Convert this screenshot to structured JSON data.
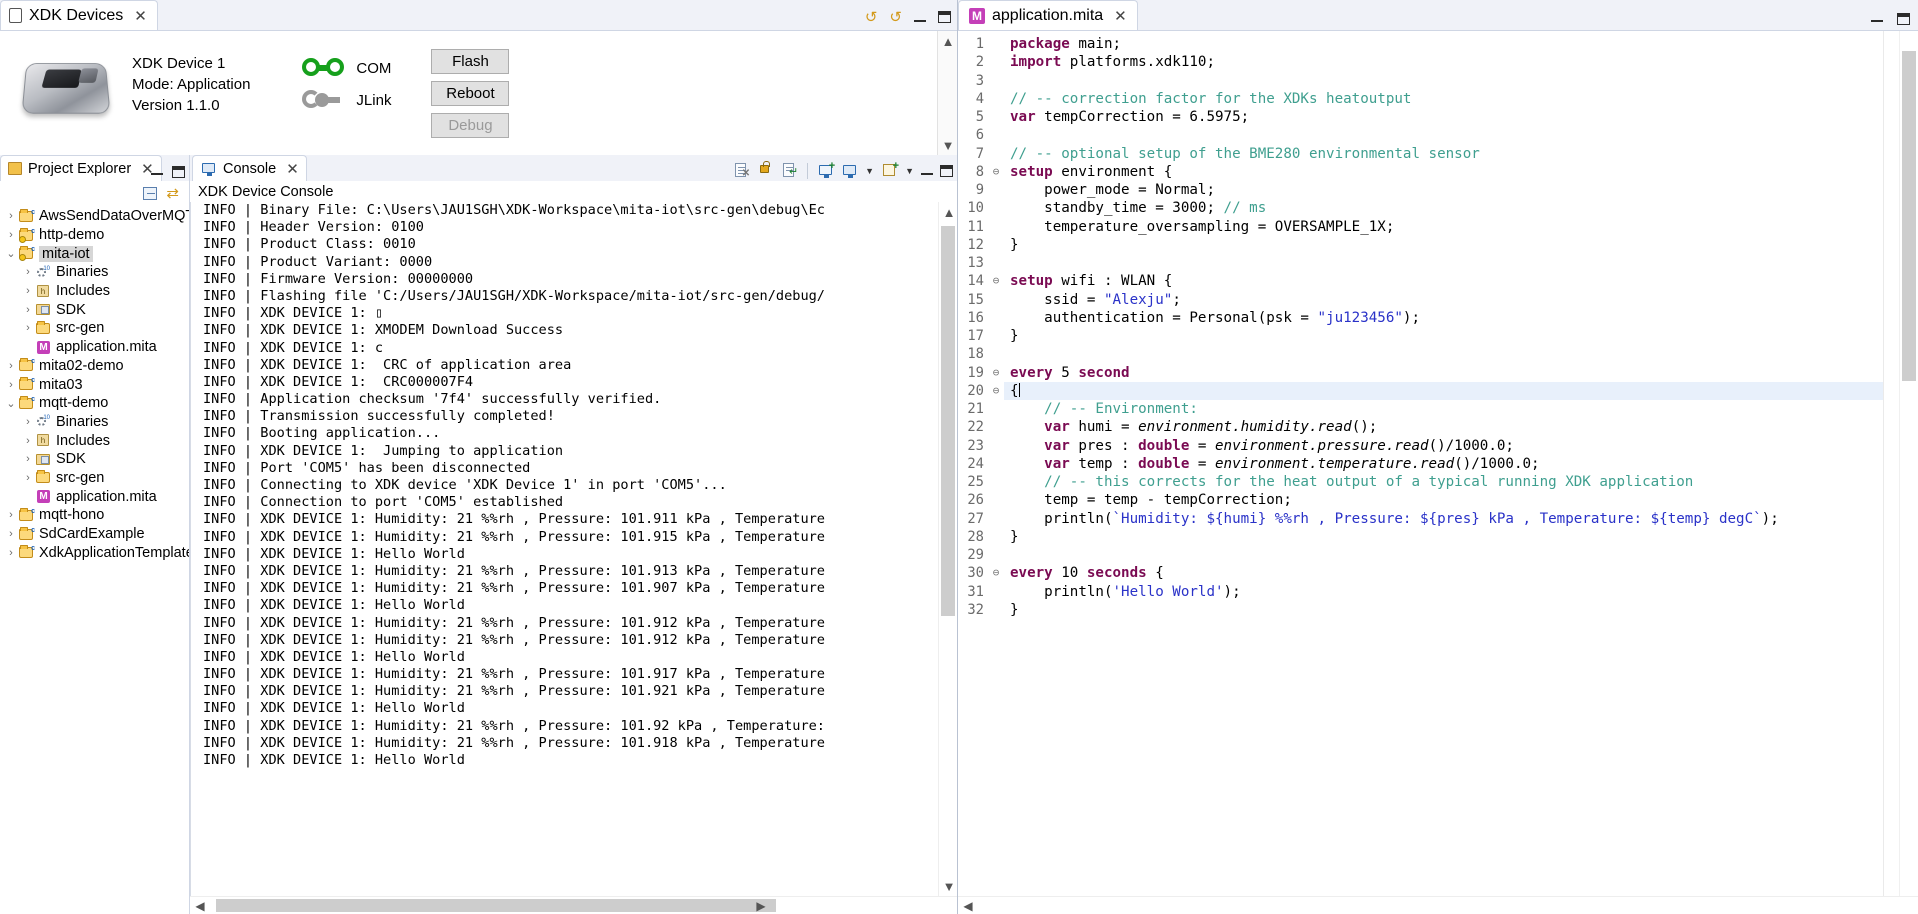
{
  "xdk_view": {
    "tab_label": "XDK Devices",
    "tab_close": "✕",
    "device_name": "XDK Device 1",
    "device_mode": "Mode: Application",
    "device_version": "Version 1.1.0",
    "connections": [
      {
        "label": "COM",
        "state": "on"
      },
      {
        "label": "JLink",
        "state": "off"
      }
    ],
    "buttons": [
      {
        "label": "Flash",
        "enabled": true
      },
      {
        "label": "Reboot",
        "enabled": true
      },
      {
        "label": "Debug",
        "enabled": false
      }
    ],
    "toolbar_icons": [
      "refresh-devices-icon",
      "refresh-device-console-icon",
      "minimize-icon",
      "maximize-icon"
    ]
  },
  "project_explorer": {
    "tab_label": "Project Explorer",
    "tab_close": "✕",
    "toolbar_icons": [
      "collapse-all-icon",
      "link-with-editor-icon"
    ],
    "tree": [
      {
        "label": "AwsSendDataOverMQTT",
        "indent": 0,
        "state": "collapsed",
        "icon": "c-project-folder",
        "selected": false
      },
      {
        "label": "http-demo",
        "indent": 0,
        "state": "collapsed",
        "icon": "c-project-folder-warn",
        "selected": false
      },
      {
        "label": "mita-iot",
        "indent": 0,
        "state": "expanded",
        "icon": "c-project-folder-warn",
        "selected": true
      },
      {
        "label": "Binaries",
        "indent": 1,
        "state": "collapsed",
        "icon": "binaries",
        "selected": false
      },
      {
        "label": "Includes",
        "indent": 1,
        "state": "collapsed",
        "icon": "includes",
        "selected": false
      },
      {
        "label": "SDK",
        "indent": 1,
        "state": "collapsed",
        "icon": "sdk-folder",
        "selected": false
      },
      {
        "label": "src-gen",
        "indent": 1,
        "state": "collapsed",
        "icon": "src-folder",
        "selected": false
      },
      {
        "label": "application.mita",
        "indent": 1,
        "state": "leaf",
        "icon": "mita-file",
        "selected": false
      },
      {
        "label": "mita02-demo",
        "indent": 0,
        "state": "collapsed",
        "icon": "c-project-folder",
        "selected": false
      },
      {
        "label": "mita03",
        "indent": 0,
        "state": "collapsed",
        "icon": "c-project-folder",
        "selected": false
      },
      {
        "label": "mqtt-demo",
        "indent": 0,
        "state": "expanded",
        "icon": "c-project-folder",
        "selected": false
      },
      {
        "label": "Binaries",
        "indent": 1,
        "state": "collapsed",
        "icon": "binaries",
        "selected": false
      },
      {
        "label": "Includes",
        "indent": 1,
        "state": "collapsed",
        "icon": "includes",
        "selected": false
      },
      {
        "label": "SDK",
        "indent": 1,
        "state": "collapsed",
        "icon": "sdk-folder",
        "selected": false
      },
      {
        "label": "src-gen",
        "indent": 1,
        "state": "collapsed",
        "icon": "src-folder",
        "selected": false
      },
      {
        "label": "application.mita",
        "indent": 1,
        "state": "leaf",
        "icon": "mita-file",
        "selected": false
      },
      {
        "label": "mqtt-hono",
        "indent": 0,
        "state": "collapsed",
        "icon": "c-project-folder",
        "selected": false
      },
      {
        "label": "SdCardExample",
        "indent": 0,
        "state": "collapsed",
        "icon": "c-project-folder",
        "selected": false
      },
      {
        "label": "XdkApplicationTemplate",
        "indent": 0,
        "state": "collapsed",
        "icon": "c-project-folder",
        "selected": false
      }
    ]
  },
  "console": {
    "tab_label": "Console",
    "tab_close": "✕",
    "title": "XDK Device Console",
    "toolbar_icons": [
      "clear-console-icon",
      "scroll-lock-icon",
      "pin-console-icon",
      "display-selected-console-icon",
      "open-console-icon",
      "minimize-icon",
      "maximize-icon"
    ],
    "lines": [
      "INFO | Binary File: C:\\Users\\JAU1SGH\\XDK-Workspace\\mita-iot\\src-gen\\debug\\Ec",
      "INFO | Header Version: 0100",
      "INFO | Product Class: 0010",
      "INFO | Product Variant: 0000",
      "INFO | Firmware Version: 00000000",
      "INFO | Flashing file 'C:/Users/JAU1SGH/XDK-Workspace/mita-iot/src-gen/debug/",
      "INFO | XDK DEVICE 1: ▯",
      "INFO | XDK DEVICE 1: XMODEM Download Success",
      "INFO | XDK DEVICE 1: c",
      "INFO | XDK DEVICE 1:  CRC of application area",
      "INFO | XDK DEVICE 1:  CRC000007F4",
      "INFO | Application checksum '7f4' successfully verified.",
      "INFO | Transmission successfully completed!",
      "INFO | Booting application...",
      "INFO | XDK DEVICE 1:  Jumping to application",
      "INFO | Port 'COM5' has been disconnected",
      "INFO | Connecting to XDK device 'XDK Device 1' in port 'COM5'...",
      "INFO | Connection to port 'COM5' established",
      "INFO | XDK DEVICE 1: Humidity: 21 %%rh , Pressure: 101.911 kPa , Temperature",
      "INFO | XDK DEVICE 1: Humidity: 21 %%rh , Pressure: 101.915 kPa , Temperature",
      "INFO | XDK DEVICE 1: Hello World",
      "INFO | XDK DEVICE 1: Humidity: 21 %%rh , Pressure: 101.913 kPa , Temperature",
      "INFO | XDK DEVICE 1: Humidity: 21 %%rh , Pressure: 101.907 kPa , Temperature",
      "INFO | XDK DEVICE 1: Hello World",
      "INFO | XDK DEVICE 1: Humidity: 21 %%rh , Pressure: 101.912 kPa , Temperature",
      "INFO | XDK DEVICE 1: Humidity: 21 %%rh , Pressure: 101.912 kPa , Temperature",
      "INFO | XDK DEVICE 1: Hello World",
      "INFO | XDK DEVICE 1: Humidity: 21 %%rh , Pressure: 101.917 kPa , Temperature",
      "INFO | XDK DEVICE 1: Humidity: 21 %%rh , Pressure: 101.921 kPa , Temperature",
      "INFO | XDK DEVICE 1: Hello World",
      "INFO | XDK DEVICE 1: Humidity: 21 %%rh , Pressure: 101.92 kPa , Temperature:",
      "INFO | XDK DEVICE 1: Humidity: 21 %%rh , Pressure: 101.918 kPa , Temperature",
      "INFO | XDK DEVICE 1: Hello World"
    ]
  },
  "editor": {
    "tab_label": "application.mita",
    "tab_close": "✕",
    "tab_icon_letter": "M",
    "current_line": 20,
    "window_controls": [
      "minimize-icon",
      "maximize-icon"
    ],
    "lines": [
      {
        "n": 1,
        "fold": "",
        "html": "<span class=\"kw\">package</span> main;"
      },
      {
        "n": 2,
        "fold": "",
        "html": "<span class=\"kw\">import</span> platforms.xdk110;"
      },
      {
        "n": 3,
        "fold": "",
        "html": ""
      },
      {
        "n": 4,
        "fold": "",
        "html": "<span class=\"cm\">// -- correction factor for the XDKs heatoutput</span>"
      },
      {
        "n": 5,
        "fold": "",
        "html": "<span class=\"kw\">var</span> tempCorrection = 6.5975;"
      },
      {
        "n": 6,
        "fold": "",
        "html": ""
      },
      {
        "n": 7,
        "fold": "",
        "html": "<span class=\"cm\">// -- optional setup of the BME280 environmental sensor</span>"
      },
      {
        "n": 8,
        "fold": "⊖",
        "html": "<span class=\"kw\">setup</span> environment {"
      },
      {
        "n": 9,
        "fold": "",
        "html": "    power_mode = Normal;"
      },
      {
        "n": 10,
        "fold": "",
        "html": "    standby_time = 3000; <span class=\"cm\">// ms</span>"
      },
      {
        "n": 11,
        "fold": "",
        "html": "    temperature_oversampling = OVERSAMPLE_1X;"
      },
      {
        "n": 12,
        "fold": "",
        "html": "}"
      },
      {
        "n": 13,
        "fold": "",
        "html": ""
      },
      {
        "n": 14,
        "fold": "⊖",
        "html": "<span class=\"kw\">setup</span> wifi : WLAN {"
      },
      {
        "n": 15,
        "fold": "",
        "html": "    ssid = <span class=\"st\">\"Alexju\"</span>;"
      },
      {
        "n": 16,
        "fold": "",
        "html": "    authentication = Personal(psk = <span class=\"st\">\"ju123456\"</span>);"
      },
      {
        "n": 17,
        "fold": "",
        "html": "}"
      },
      {
        "n": 18,
        "fold": "",
        "html": ""
      },
      {
        "n": 19,
        "fold": "⊖",
        "html": "<span class=\"kw\">every</span> 5 <span class=\"kw\">second</span>"
      },
      {
        "n": 20,
        "fold": "⊖",
        "html": "{<span class=\"caret-bar\"></span>"
      },
      {
        "n": 21,
        "fold": "",
        "html": "    <span class=\"cm\">// -- Environment:</span>"
      },
      {
        "n": 22,
        "fold": "",
        "html": "    <span class=\"kw\">var</span> humi = <span class=\"it\">environment.humidity.read</span>();"
      },
      {
        "n": 23,
        "fold": "",
        "html": "    <span class=\"kw\">var</span> pres : <span class=\"kw\">double</span> = <span class=\"it\">environment.pressure.read</span>()/1000.0;"
      },
      {
        "n": 24,
        "fold": "",
        "html": "    <span class=\"kw\">var</span> temp : <span class=\"kw\">double</span> = <span class=\"it\">environment.temperature.read</span>()/1000.0;"
      },
      {
        "n": 25,
        "fold": "",
        "html": "    <span class=\"cm\">// -- this corrects for the heat output of a typical running XDK application</span>"
      },
      {
        "n": 26,
        "fold": "",
        "html": "    temp = temp - tempCorrection;"
      },
      {
        "n": 27,
        "fold": "",
        "html": "    println(<span class=\"st\">`Humidity: ${humi} %%rh , Pressure: ${pres} kPa , Temperature: ${temp} degC`</span>);"
      },
      {
        "n": 28,
        "fold": "",
        "html": "}"
      },
      {
        "n": 29,
        "fold": "",
        "html": ""
      },
      {
        "n": 30,
        "fold": "⊖",
        "html": "<span class=\"kw\">every</span> 10 <span class=\"kw\">seconds</span> {"
      },
      {
        "n": 31,
        "fold": "",
        "html": "    println(<span class=\"st\">'Hello World'</span>);"
      },
      {
        "n": 32,
        "fold": "",
        "html": "}"
      }
    ]
  },
  "colors": {
    "keyword": "#7a0a52",
    "comment": "#3f9f8f",
    "string": "#2a32c8",
    "tab_bar": "#f0f2f8",
    "selection": "#e8f0fb",
    "connected": "#16a01c",
    "disconnected": "#9a9a9a",
    "mita_badge": "#c43fb8"
  }
}
